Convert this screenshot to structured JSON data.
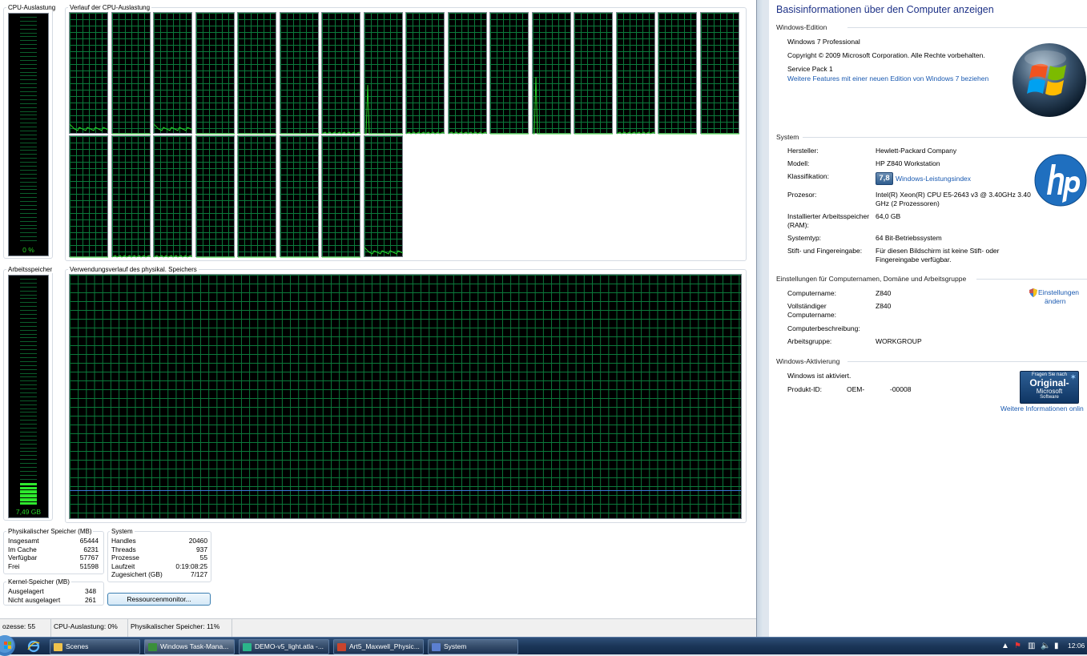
{
  "taskmgr": {
    "cpu_usage_label": "CPU-Auslastung",
    "cpu_history_label": "Verlauf der CPU-Auslastung",
    "cpu_usage_value": "0 %",
    "cpu_usage_fraction": 0.0,
    "memory_label": "Arbeitsspeicher",
    "memory_history_label": "Verwendungsverlauf des physikal. Speichers",
    "memory_value": "7,49 GB",
    "memory_fraction": 0.11,
    "physical_memory": {
      "title": "Physikalischer Speicher (MB)",
      "rows": [
        {
          "label": "Insgesamt",
          "value": "65444"
        },
        {
          "label": "Im Cache",
          "value": "6231"
        },
        {
          "label": "Verfügbar",
          "value": "57767"
        },
        {
          "label": "Frei",
          "value": "51598"
        }
      ]
    },
    "kernel_memory": {
      "title": "Kernel-Speicher (MB)",
      "rows": [
        {
          "label": "Ausgelagert",
          "value": "348"
        },
        {
          "label": "Nicht ausgelagert",
          "value": "261"
        }
      ]
    },
    "system": {
      "title": "System",
      "rows": [
        {
          "label": "Handles",
          "value": "20460"
        },
        {
          "label": "Threads",
          "value": "937"
        },
        {
          "label": "Prozesse",
          "value": "55"
        },
        {
          "label": "Laufzeit",
          "value": "0:19:08:25"
        },
        {
          "label": "Zugesichert (GB)",
          "value": "7/127"
        }
      ]
    },
    "resource_monitor_button": "Ressourcenmonitor...",
    "statusbar": {
      "processes": "ozesse: 55",
      "cpu": "CPU-Auslastung: 0%",
      "memory": "Physikalischer Speicher: 11%"
    }
  },
  "system_window": {
    "heading": "Basisinformationen über den Computer anzeigen",
    "edition": {
      "title": "Windows-Edition",
      "name": "Windows 7 Professional",
      "copyright": "Copyright © 2009 Microsoft Corporation. Alle Rechte vorbehalten.",
      "service_pack": "Service Pack 1",
      "more_features_link": "Weitere Features mit einer neuen Edition von Windows 7 beziehen"
    },
    "system": {
      "title": "System",
      "manufacturer_label": "Hersteller:",
      "manufacturer": "Hewlett-Packard Company",
      "model_label": "Modell:",
      "model": "HP Z840 Workstation",
      "rating_label": "Klassifikation:",
      "rating_score": "7,8",
      "rating_link": "Windows-Leistungsindex",
      "processor_label": "Prozesor:",
      "processor_line1": "Intel(R) Xeon(R) CPU E5-2643 v3 @ 3.40GHz   3.40",
      "processor_line2": "GHz  (2 Prozessoren)",
      "ram_label_line1": "Installierter Arbeitsspeicher",
      "ram_label_line2": "(RAM):",
      "ram": "64,0 GB",
      "type_label": "Systemtyp:",
      "type": "64 Bit-Betriebssystem",
      "pen_label": "Stift- und Fingereingabe:",
      "pen_line1": "Für diesen Bildschirm ist keine Stift- oder",
      "pen_line2": "Fingereingabe verfügbar."
    },
    "computer_name": {
      "title": "Einstellungen für Computernamen, Domäne und Arbeitsgruppe",
      "name_label": "Computername:",
      "name": "Z840",
      "full_label_line1": "Vollständiger",
      "full_label_line2": "Computername:",
      "full": "Z840",
      "desc_label": "Computerbeschreibung:",
      "workgroup_label": "Arbeitsgruppe:",
      "workgroup": "WORKGROUP",
      "change_settings_line1": "Einstellungen",
      "change_settings_line2": "ändern"
    },
    "activation": {
      "title": "Windows-Aktivierung",
      "status": "Windows ist aktiviert.",
      "product_id_label": "Produkt-ID:",
      "product_id_a": "OEM-",
      "product_id_b": "-00008",
      "badge_line1": "Fragen Sie nach",
      "badge_line2": "Original-",
      "badge_line3": "Microsoft",
      "badge_line4": "Software",
      "more_info_link": "Weitere Informationen onlin"
    }
  },
  "taskbar": {
    "buttons": [
      {
        "label": "Scenes"
      },
      {
        "label": "Windows Task-Mana..."
      },
      {
        "label": "DEMO-v5_light.atla -..."
      },
      {
        "label": "Art5_Maxwell_Physic..."
      },
      {
        "label": "System"
      }
    ],
    "clock": "12:06"
  },
  "colors": {
    "graph_grid": "#0b7a3b",
    "graph_line": "#27d027",
    "memory_line": "#3a78d8",
    "link": "#1a5ab1",
    "heading": "#1e3287"
  }
}
